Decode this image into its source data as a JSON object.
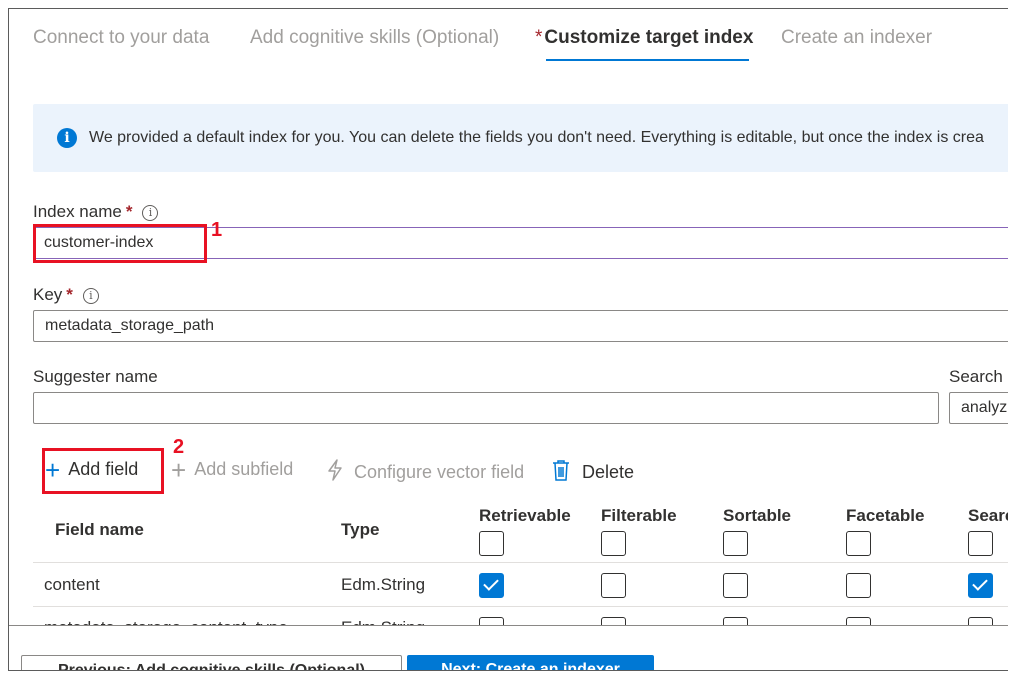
{
  "wizard": {
    "tabs": [
      {
        "label": "Connect to your data"
      },
      {
        "label": "Add cognitive skills (Optional)"
      },
      {
        "label": "Customize target index",
        "required_marker": "*"
      },
      {
        "label": "Create an indexer"
      }
    ],
    "active_tab": 2
  },
  "info": {
    "icon": "info-icon",
    "text": "We provided a default index for you. You can delete the fields you don't need. Everything is editable, but once the index is crea"
  },
  "form": {
    "index_name": {
      "label": "Index name",
      "required": "*",
      "value": "customer-index"
    },
    "key": {
      "label": "Key",
      "required": "*",
      "value": "metadata_storage_path"
    },
    "suggester_name": {
      "label": "Suggester name",
      "value": ""
    },
    "search_mode": {
      "label": "Search",
      "value": "analyz"
    }
  },
  "annotations": {
    "one": "1",
    "two": "2"
  },
  "toolbar": {
    "add_field": "Add field",
    "add_subfield": "Add subfield",
    "configure_vector_field": "Configure vector field",
    "delete": "Delete"
  },
  "table": {
    "columns": [
      "Field name",
      "Type",
      "Retrievable",
      "Filterable",
      "Sortable",
      "Facetable",
      "Searc"
    ],
    "rows": [
      {
        "name": "content",
        "type": "Edm.String",
        "checks": [
          true,
          false,
          false,
          false,
          true
        ]
      },
      {
        "name": "metadata_storage_content_type",
        "type": "Edm.String",
        "checks": [
          false,
          false,
          false,
          false,
          false
        ]
      }
    ]
  },
  "footer": {
    "previous": "Previous: Add cognitive skills (Optional)",
    "next": "Next: Create an indexer"
  },
  "colors": {
    "accent": "#0078d4",
    "required": "#a4262c",
    "annotation": "#e81123",
    "info_bg": "#ebf3fc"
  }
}
